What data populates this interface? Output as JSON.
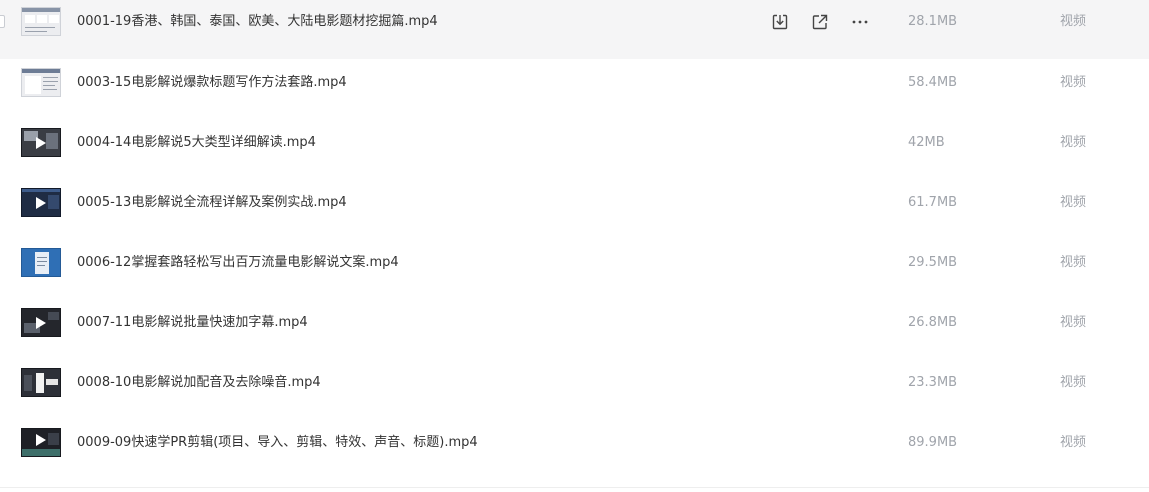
{
  "actions": {
    "download_icon": "download-icon",
    "share_icon": "share-icon",
    "more_icon": "more-icon"
  },
  "files": [
    {
      "name": "0001-19香港、韩国、泰国、欧美、大陆电影题材挖掘篇.mp4",
      "size": "28.1MB",
      "type": "视频"
    },
    {
      "name": "0003-15电影解说爆款标题写作方法套路.mp4",
      "size": "58.4MB",
      "type": "视频"
    },
    {
      "name": "0004-14电影解说5大类型详细解读.mp4",
      "size": "42MB",
      "type": "视频"
    },
    {
      "name": "0005-13电影解说全流程详解及案例实战.mp4",
      "size": "61.7MB",
      "type": "视频"
    },
    {
      "name": "0006-12掌握套路轻松写出百万流量电影解说文案.mp4",
      "size": "29.5MB",
      "type": "视频"
    },
    {
      "name": "0007-11电影解说批量快速加字幕.mp4",
      "size": "26.8MB",
      "type": "视频"
    },
    {
      "name": "0008-10电影解说加配音及去除噪音.mp4",
      "size": "23.3MB",
      "type": "视频"
    },
    {
      "name": "0009-09快速学PR剪辑(项目、导入、剪辑、特效、声音、标题).mp4",
      "size": "89.9MB",
      "type": "视频"
    }
  ]
}
